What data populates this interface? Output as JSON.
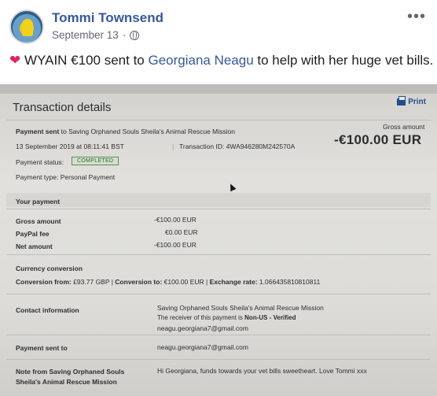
{
  "post": {
    "author": "Tommi Townsend",
    "date": "September 13",
    "separator": "·",
    "privacy_icon": "globe-icon",
    "more_icon": "ellipsis-icon",
    "text_before": "WYAIN €100 sent to ",
    "mention": "Georgiana Neagu",
    "text_after": " to help with her huge vet bills. ",
    "heart": "❤"
  },
  "transaction": {
    "title": "Transaction details",
    "print_label": "Print",
    "payment_sent_prefix": "Payment sent",
    "payment_sent_to": " to Saving Orphaned Souls Sheila's Animal Rescue Mission",
    "date_time": "13 September 2019 at 08:11:41 BST",
    "transaction_id_label": "Transaction ID: 4WA946280M242570A",
    "gross_amount_label": "Gross amount",
    "gross_amount_value": "-€100.00 EUR",
    "payment_status_label": "Payment status:",
    "payment_status_value": "COMPLETED",
    "payment_type": "Payment type: Personal Payment",
    "your_payment_heading": "Your payment",
    "gross_label": "Gross amount",
    "gross_value": "-€100.00 EUR",
    "fee_label": "PayPal fee",
    "fee_value": "€0.00 EUR",
    "net_label": "Net amount",
    "net_value": "-€100.00 EUR",
    "currency_heading": "Currency conversion",
    "conversion_from_label": "Conversion from:",
    "conversion_from_value": " £93.77 GBP | ",
    "conversion_to_label": "Conversion to:",
    "conversion_to_value": " €100.00 EUR | ",
    "exchange_rate_label": "Exchange rate:",
    "exchange_rate_value": " 1.066435810810811",
    "contact_label": "Contact information",
    "contact_name": "Saving Orphaned Souls Sheila's Animal Rescue Mission",
    "receiver_text": "The receiver of this payment is ",
    "receiver_status": "Non-US - Verified",
    "contact_email": "neagu.georgiana7@gmail.com",
    "payment_sent_to_label": "Payment sent to",
    "payment_sent_to_email": "neagu.georgiana7@gmail.com",
    "note_label_1": "Note from Saving Orphaned Souls",
    "note_label_2": "Sheila's Animal Rescue Mission",
    "note_text": "Hi Georgiana, funds towards your vet bills sweetheart. Love Tommi xxx"
  },
  "colors": {
    "facebook_link": "#385898",
    "heart": "#e0245e",
    "paypal_blue": "#1e4e8c",
    "completed_green": "#2c6d2c"
  }
}
